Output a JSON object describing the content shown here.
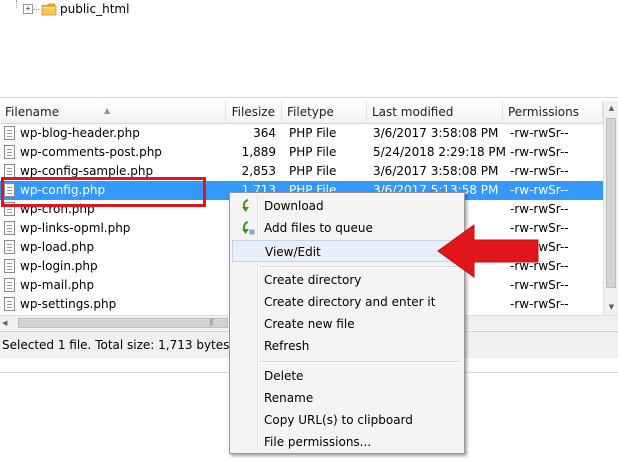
{
  "tree": {
    "folder_label": "public_html",
    "expand_symbol": "+"
  },
  "list": {
    "columns": [
      "Filename",
      "Filesize",
      "Filetype",
      "Last modified",
      "Permissions"
    ],
    "rows": [
      {
        "name": "wp-blog-header.php",
        "size": "364",
        "type": "PHP File",
        "modified": "3/6/2017 3:58:08 PM",
        "perm": "-rw-rwSr--"
      },
      {
        "name": "wp-comments-post.php",
        "size": "1,889",
        "type": "PHP File",
        "modified": "5/24/2018 2:29:18 PM",
        "perm": "-rw-rwSr--"
      },
      {
        "name": "wp-config-sample.php",
        "size": "2,853",
        "type": "PHP File",
        "modified": "3/6/2017 3:58:08 PM",
        "perm": "-rw-rwSr--"
      },
      {
        "name": "wp-config.php",
        "size": "1,713",
        "type": "PHP File",
        "modified": "3/6/2017 5:13:58 PM",
        "perm": "-rw-rwSr--"
      },
      {
        "name": "wp-cron.php",
        "size": "",
        "type": "",
        "modified": "",
        "perm": "-rw-rwSr--"
      },
      {
        "name": "wp-links-opml.php",
        "size": "",
        "type": "",
        "modified": "",
        "perm": "-rw-rwSr--"
      },
      {
        "name": "wp-load.php",
        "size": "",
        "type": "",
        "modified": "",
        "perm": "-rw-rwSr--"
      },
      {
        "name": "wp-login.php",
        "size": "",
        "type": "",
        "modified": "",
        "perm": "-rw-rwSr--"
      },
      {
        "name": "wp-mail.php",
        "size": "",
        "type": "",
        "modified": "",
        "perm": "-rw-rwSr--"
      },
      {
        "name": "wp-settings.php",
        "size": "",
        "type": "",
        "modified": "",
        "perm": "-rw-rwSr--"
      }
    ],
    "selected_index": 3
  },
  "status": {
    "text": "Selected 1 file. Total size: 1,713 bytes"
  },
  "menu": {
    "download": "Download",
    "add_to_queue": "Add files to queue",
    "view_edit": "View/Edit",
    "create_dir": "Create directory",
    "create_dir_enter": "Create directory and enter it",
    "create_file": "Create new file",
    "refresh": "Refresh",
    "delete": "Delete",
    "rename": "Rename",
    "copy_url": "Copy URL(s) to clipboard",
    "file_permissions": "File permissions..."
  },
  "colors": {
    "selection": "#3399ff",
    "annotation_red": "#e0161c",
    "icon_green": "#3a9a1c"
  }
}
